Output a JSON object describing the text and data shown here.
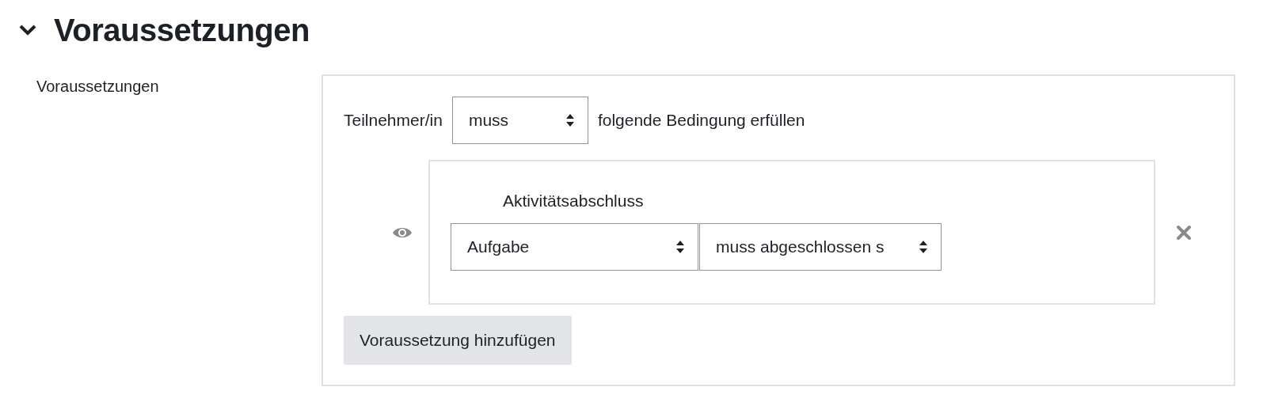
{
  "section": {
    "title": "Voraussetzungen",
    "expanded": true
  },
  "field_label": "Voraussetzungen",
  "condition_set": {
    "prefix": "Teilnehmer/in",
    "mode_select": "muss",
    "suffix": "folgende Bedingung erfüllen",
    "conditions": [
      {
        "title": "Aktivitätsabschluss",
        "selects": [
          "Aufgabe",
          "muss abgeschlossen s"
        ]
      }
    ],
    "add_button": "Voraussetzung hinzufügen"
  }
}
